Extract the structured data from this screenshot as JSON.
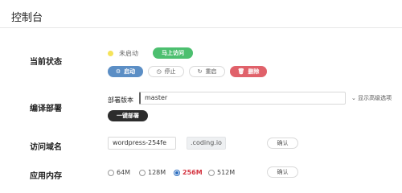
{
  "header": {
    "title": "控制台"
  },
  "status": {
    "label": "当前状态",
    "state_text": "未启动",
    "visit_button": "马上访问",
    "actions": [
      {
        "label": "启动",
        "icon": "gear-icon"
      },
      {
        "label": "停止",
        "icon": "clock-icon"
      },
      {
        "label": "重启",
        "icon": "refresh-icon"
      },
      {
        "label": "删除",
        "icon": "trash-icon"
      }
    ]
  },
  "deploy": {
    "label": "编译部署",
    "version_label": "部署版本",
    "version_value": "master",
    "advanced_toggle": "显示高级选项",
    "deploy_button": "一键部署"
  },
  "domain": {
    "label": "访问域名",
    "subdomain_value": "wordpress-254fe",
    "suffix": ".coding.io",
    "confirm_button": "确认"
  },
  "memory": {
    "label": "应用内存",
    "options": [
      "64M",
      "128M",
      "256M",
      "512M"
    ],
    "selected": "256M",
    "confirm_button": "确认"
  }
}
